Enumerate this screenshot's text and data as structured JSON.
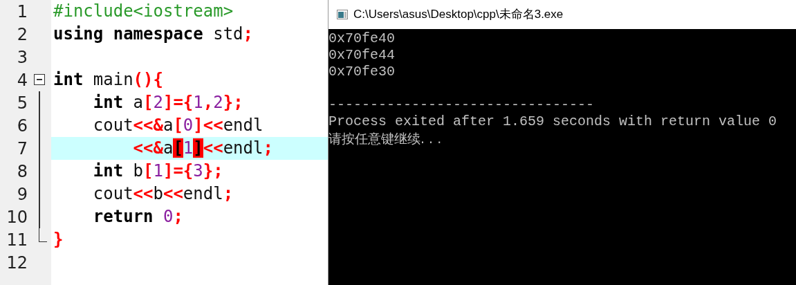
{
  "editor": {
    "lines": [
      {
        "number": "1",
        "current": false,
        "tokens": [
          {
            "kind": "pre",
            "text": "#include<iostream>"
          }
        ]
      },
      {
        "number": "2",
        "current": false,
        "tokens": [
          {
            "kind": "kw",
            "text": "using"
          },
          {
            "kind": "kw",
            "text": " namespace"
          },
          {
            "kind": "plain",
            "text": " std"
          },
          {
            "kind": "op",
            "text": ";"
          }
        ]
      },
      {
        "number": "3",
        "current": false
      },
      {
        "number": "4",
        "current": false,
        "expanded": true,
        "tokens": [
          {
            "kind": "kw",
            "text": "int"
          },
          {
            "kind": "plain",
            "text": " main"
          },
          {
            "kind": "op",
            "text": "(){"
          }
        ],
        "children": [
          {
            "number": "5",
            "current": false,
            "tokens": [
              {
                "kind": "kw",
                "text": "    int"
              },
              {
                "kind": "plain",
                "text": " a"
              },
              {
                "kind": "op",
                "text": "["
              },
              {
                "kind": "num",
                "text": "2"
              },
              {
                "kind": "op",
                "text": "]={"
              },
              {
                "kind": "num",
                "text": "1"
              },
              {
                "kind": "op",
                "text": ","
              },
              {
                "kind": "num",
                "text": "2"
              },
              {
                "kind": "op",
                "text": "};"
              }
            ]
          },
          {
            "number": "6",
            "current": false,
            "tokens": [
              {
                "kind": "plain",
                "text": "    cout"
              },
              {
                "kind": "op",
                "text": "<<&"
              },
              {
                "kind": "plain",
                "text": "a"
              },
              {
                "kind": "op",
                "text": "["
              },
              {
                "kind": "num",
                "text": "0"
              },
              {
                "kind": "op",
                "text": "]<<"
              },
              {
                "kind": "plain",
                "text": "endl"
              }
            ]
          },
          {
            "number": "7",
            "current": true,
            "tokens": [
              {
                "kind": "op",
                "text": "        <<&"
              },
              {
                "kind": "plain",
                "text": "a"
              },
              {
                "kind": "match",
                "text": "["
              },
              {
                "kind": "num",
                "text": "1"
              },
              {
                "kind": "match",
                "text": "]"
              },
              {
                "kind": "op",
                "text": "<<"
              },
              {
                "kind": "plain",
                "text": "endl"
              },
              {
                "kind": "op",
                "text": ";"
              }
            ]
          },
          {
            "number": "8",
            "current": false,
            "tokens": [
              {
                "kind": "kw",
                "text": "    int"
              },
              {
                "kind": "plain",
                "text": " b"
              },
              {
                "kind": "op",
                "text": "["
              },
              {
                "kind": "num",
                "text": "1"
              },
              {
                "kind": "op",
                "text": "]={"
              },
              {
                "kind": "num",
                "text": "3"
              },
              {
                "kind": "op",
                "text": "};"
              }
            ]
          },
          {
            "number": "9",
            "current": false,
            "tokens": [
              {
                "kind": "plain",
                "text": "    cout"
              },
              {
                "kind": "op",
                "text": "<<"
              },
              {
                "kind": "plain",
                "text": "b"
              },
              {
                "kind": "op",
                "text": "<<"
              },
              {
                "kind": "plain",
                "text": "endl"
              },
              {
                "kind": "op",
                "text": ";"
              }
            ]
          },
          {
            "number": "10",
            "current": false,
            "tokens": [
              {
                "kind": "kw",
                "text": "    return"
              },
              {
                "kind": "num",
                "text": " 0"
              },
              {
                "kind": "op",
                "text": ";"
              }
            ]
          },
          {
            "number": "11",
            "current": false,
            "tokens": [
              {
                "kind": "op",
                "text": "}"
              }
            ]
          }
        ]
      },
      {
        "number": "12",
        "current": false
      }
    ]
  },
  "console": {
    "title": "C:\\Users\\asus\\Desktop\\cpp\\未命名3.exe",
    "output": [
      "0x70fe40",
      "0x70fe44",
      "0x70fe30"
    ],
    "separator": "--------------------------------",
    "messages": [
      "Process exited after 1.659 seconds with return value 0",
      "请按任意键继续. . ."
    ]
  }
}
